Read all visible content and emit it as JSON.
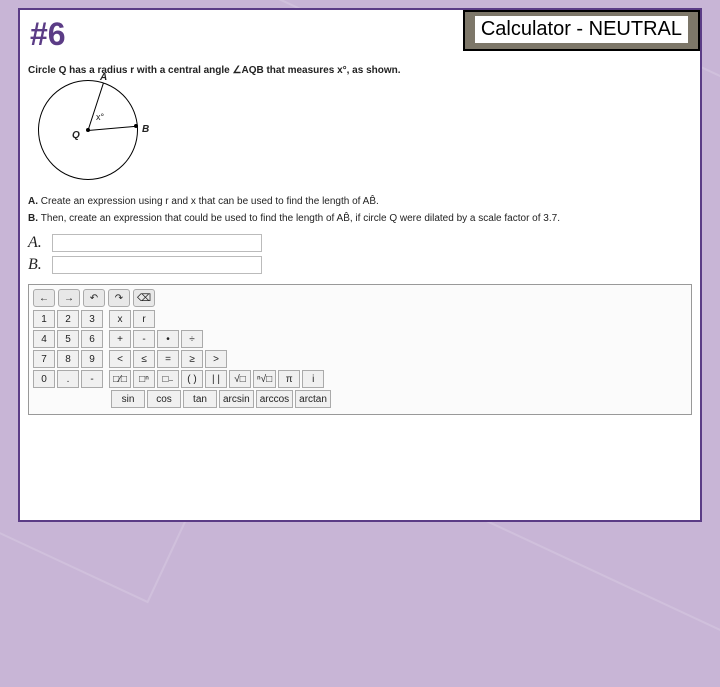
{
  "header": {
    "question_number": "#6",
    "badge": "Calculator - NEUTRAL"
  },
  "stem": "Circle Q has a radius r with a central angle ∠AQB that measures x°, as shown.",
  "figure": {
    "center_label": "Q",
    "point_a": "A",
    "point_b": "B",
    "angle_label": "x°"
  },
  "parts": {
    "a_prefix": "A.",
    "a_text": "Create an expression using r and x that can be used to find the length of AB̂.",
    "b_prefix": "B.",
    "b_text": "Then, create an expression that could be used to find the length of AB̂, if circle Q were dilated by a scale factor of 3.7."
  },
  "answers": {
    "a_label": "A.",
    "b_label": "B."
  },
  "palette": {
    "nav": [
      "←",
      "→",
      "↶",
      "↷",
      "⌫"
    ],
    "row1": [
      "1",
      "2",
      "3",
      "x",
      "r"
    ],
    "row2": [
      "4",
      "5",
      "6",
      "+",
      "-",
      "•",
      "÷"
    ],
    "row3": [
      "7",
      "8",
      "9",
      "<",
      "≤",
      "=",
      "≥",
      ">"
    ],
    "row4": [
      "0",
      ".",
      "-",
      "□⁄□",
      "□ⁿ",
      "□₋",
      "( )",
      "| |",
      "√□",
      "ⁿ√□",
      "π",
      "i"
    ],
    "row5": [
      "sin",
      "cos",
      "tan",
      "arcsin",
      "arccos",
      "arctan"
    ]
  }
}
